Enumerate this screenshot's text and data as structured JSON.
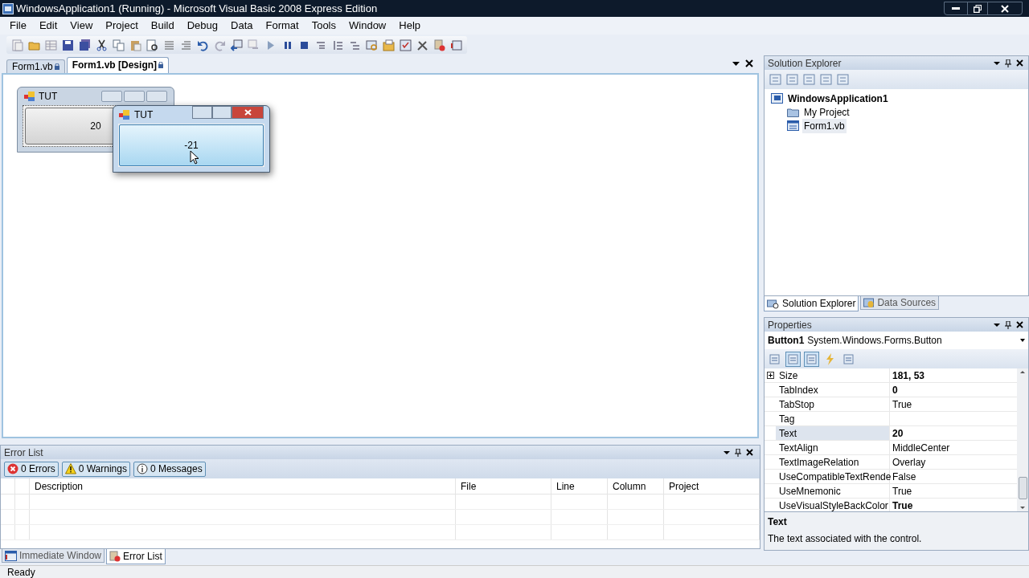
{
  "window": {
    "title": "WindowsApplication1 (Running) - Microsoft Visual Basic 2008 Express Edition"
  },
  "menu": [
    "File",
    "Edit",
    "View",
    "Project",
    "Build",
    "Debug",
    "Data",
    "Format",
    "Tools",
    "Window",
    "Help"
  ],
  "document_tabs": [
    {
      "label": "Form1.vb",
      "selected": false
    },
    {
      "label": "Form1.vb [Design]",
      "selected": true
    }
  ],
  "designer": {
    "design_form": {
      "title": "TUT",
      "button": "20"
    },
    "running_form": {
      "title": "TUT",
      "button": "-21",
      "hovered": true
    }
  },
  "error_list": {
    "title": "Error List",
    "filters": [
      {
        "kind": "error",
        "label": "0 Errors"
      },
      {
        "kind": "warning",
        "label": "0 Warnings"
      },
      {
        "kind": "info",
        "label": "0 Messages"
      }
    ],
    "columns": [
      "Description",
      "File",
      "Line",
      "Column",
      "Project"
    ]
  },
  "bottom_tabs": [
    {
      "label": "Immediate Window",
      "selected": false
    },
    {
      "label": "Error List",
      "selected": true
    }
  ],
  "solution_explorer": {
    "title": "Solution Explorer",
    "tree": [
      {
        "label": "WindowsApplication1",
        "kind": "solution",
        "selected": false,
        "children": [
          {
            "label": "My Project",
            "kind": "project",
            "selected": false
          },
          {
            "label": "Form1.vb",
            "kind": "form",
            "selected": true
          }
        ]
      }
    ],
    "tabs": [
      {
        "label": "Solution Explorer",
        "selected": true
      },
      {
        "label": "Data Sources",
        "selected": false
      }
    ]
  },
  "properties": {
    "title": "Properties",
    "object_name": "Button1",
    "object_type": "System.Windows.Forms.Button",
    "rows": [
      {
        "name": "Size",
        "value": "181, 53",
        "bold": true,
        "kind": "group",
        "selected": false
      },
      {
        "name": "TabIndex",
        "value": "0",
        "bold": true,
        "kind": "plain",
        "selected": false
      },
      {
        "name": "TabStop",
        "value": "True",
        "bold": false,
        "kind": "plain",
        "selected": false
      },
      {
        "name": "Tag",
        "kind": "plain",
        "selected": false
      },
      {
        "name": "Text",
        "value": "20",
        "bold": true,
        "kind": "plain",
        "selected": true
      },
      {
        "name": "TextAlign",
        "value": "MiddleCenter",
        "bold": false,
        "kind": "plain",
        "selected": false
      },
      {
        "name": "TextImageRelation",
        "value": "Overlay",
        "bold": false,
        "kind": "plain",
        "selected": false
      },
      {
        "name": "UseCompatibleTextRende",
        "value": "False",
        "bold": false,
        "kind": "plain",
        "selected": false
      },
      {
        "name": "UseMnemonic",
        "value": "True",
        "bold": false,
        "kind": "plain",
        "selected": false
      },
      {
        "name": "UseVisualStyleBackColor",
        "value": "True",
        "bold": true,
        "kind": "plain",
        "selected": false
      }
    ],
    "description_title": "Text",
    "description": "The text associated with the control."
  },
  "status_bar": {
    "text": "Ready"
  }
}
